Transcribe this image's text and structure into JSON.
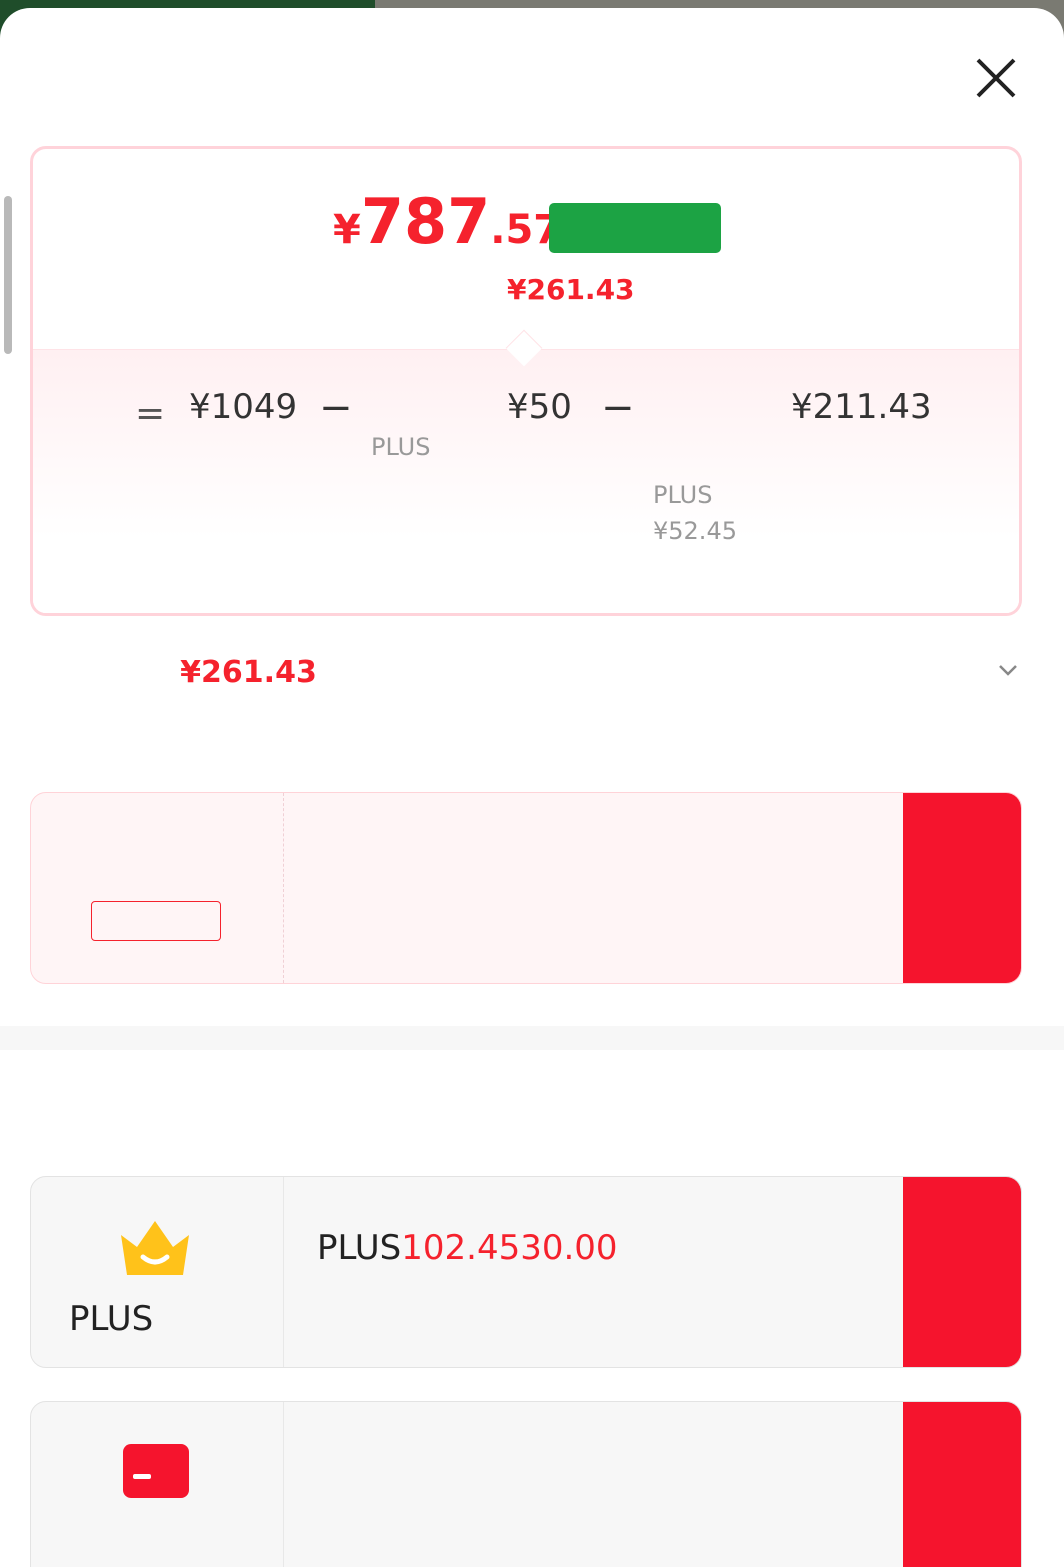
{
  "header": {
    "title": ""
  },
  "summary": {
    "price_symbol": "¥",
    "price_int": "787",
    "price_dec": ".57",
    "tag": "",
    "subtitle_label": "",
    "subtitle_value": "¥261.43"
  },
  "breakdown": {
    "eq": "=",
    "base_value": "¥1049",
    "base_label": "",
    "minus": "−",
    "sub1_value": "¥50",
    "sub1_note1": "PLUS",
    "sub1_note2": "",
    "sub2_value": "¥211.43",
    "sub2_note1": "",
    "sub2_note2": "PLUS",
    "sub2_note3": "¥52.45",
    "sub2_note4": ""
  },
  "enjoyed": {
    "label": "",
    "value": "¥261.43",
    "expand": ""
  },
  "pay_section": {
    "label": ""
  },
  "pay_offer": {
    "big": "",
    "badge": "",
    "desc": "",
    "button": ""
  },
  "open_section": {
    "title": ""
  },
  "plus_card": {
    "label": "PLUS",
    "desc_a": "PLUS",
    "desc_b": "102.45",
    "desc_c": "",
    "desc_d": "30.00",
    "desc_e": "",
    "button": ""
  },
  "jd_card": {
    "label": "",
    "desc": "",
    "button": ""
  },
  "colors": {
    "accent_red": "#f5222d",
    "tag_green": "#1ca344",
    "button_red": "#f5142d"
  },
  "icons": [
    "close-icon",
    "chevron-down-icon",
    "crown-icon",
    "card-icon"
  ]
}
